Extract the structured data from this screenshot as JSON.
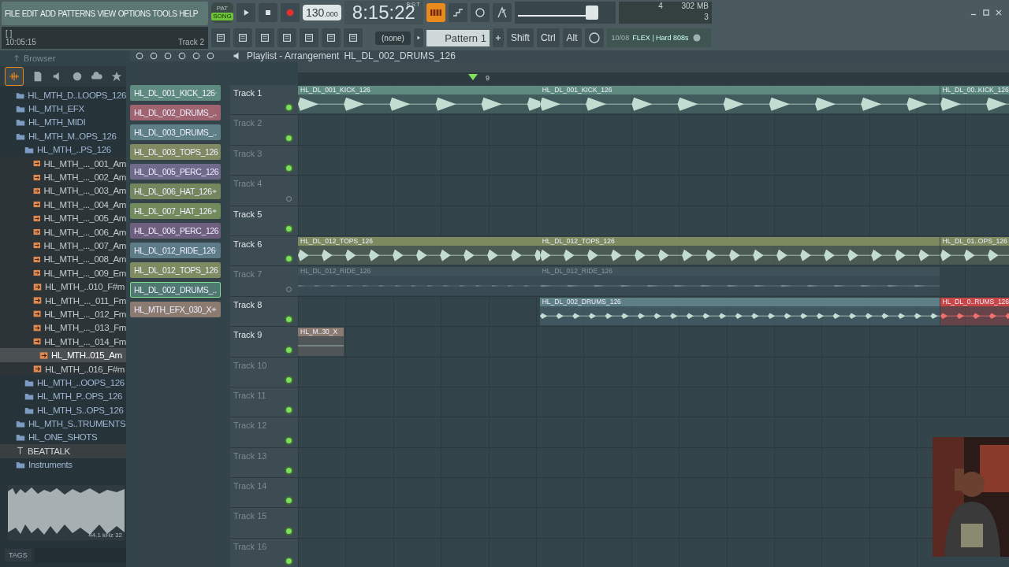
{
  "menu": [
    "FILE",
    "EDIT",
    "ADD",
    "PATTERNS",
    "VIEW",
    "OPTIONS",
    "TOOLS",
    "HELP"
  ],
  "mode": [
    {
      "label": "PAT",
      "selected": false
    },
    {
      "label": "SONG",
      "selected": true
    }
  ],
  "tempo": "130",
  "tempo_fraction": ".000",
  "time": "8:15:22",
  "time_format": "B:S:T",
  "hint": {
    "bracket": "[ ]",
    "time": "10:05:15",
    "target": "Track 2"
  },
  "cpu": {
    "polyphony": "4",
    "memory": "302 MB",
    "cores": "3"
  },
  "pattern_selector": {
    "channel": "(none)",
    "pattern": "Pattern 1"
  },
  "master_volume": {
    "level": 0.82
  },
  "modifier_keys": [
    "Shift",
    "Ctrl",
    "Alt"
  ],
  "news": {
    "date": "10/08",
    "text": "FLEX | Hard 808s"
  },
  "browser": {
    "title": "Browser",
    "tree": [
      {
        "label": "HL_MTH_D..LOOPS_126",
        "kind": "folder",
        "selected": false
      },
      {
        "label": "HL_MTH_EFX",
        "kind": "folder",
        "selected": false
      },
      {
        "label": "HL_MTH_MIDI",
        "kind": "folder",
        "selected": false
      },
      {
        "label": "HL_MTH_M..OPS_126",
        "kind": "folder",
        "selected": false,
        "children": [
          {
            "label": "HL_MTH_..PS_126",
            "kind": "folder",
            "selected": false,
            "children": [
              {
                "label": "HL_MTH_..._001_Am",
                "kind": "audio",
                "selected": false
              },
              {
                "label": "HL_MTH_..._002_Am",
                "kind": "audio",
                "selected": false
              },
              {
                "label": "HL_MTH_..._003_Am",
                "kind": "audio",
                "selected": false
              },
              {
                "label": "HL_MTH_..._004_Am",
                "kind": "audio",
                "selected": false
              },
              {
                "label": "HL_MTH_..._005_Am",
                "kind": "audio",
                "selected": false
              },
              {
                "label": "HL_MTH_..._006_Am",
                "kind": "audio",
                "selected": false
              },
              {
                "label": "HL_MTH_..._007_Am",
                "kind": "audio",
                "selected": false
              },
              {
                "label": "HL_MTH_..._008_Am",
                "kind": "audio",
                "selected": false
              },
              {
                "label": "HL_MTH_..._009_Em",
                "kind": "audio",
                "selected": false
              },
              {
                "label": "HL_MTH_..010_F#m",
                "kind": "audio",
                "selected": false
              },
              {
                "label": "HL_MTH_..._011_Fm",
                "kind": "audio",
                "selected": false
              },
              {
                "label": "HL_MTH_..._012_Fm",
                "kind": "audio",
                "selected": false
              },
              {
                "label": "HL_MTH_..._013_Fm",
                "kind": "audio",
                "selected": false
              },
              {
                "label": "HL_MTH_..._014_Fm",
                "kind": "audio",
                "selected": false
              },
              {
                "label": "HL_MTH..015_Am",
                "kind": "audio",
                "selected": true
              },
              {
                "label": "HL_MTH_..016_F#m",
                "kind": "audio",
                "selected": false
              }
            ]
          },
          {
            "label": "HL_MTH_..OOPS_126",
            "kind": "folder",
            "selected": false
          },
          {
            "label": "HL_MTH_P..OPS_126",
            "kind": "folder",
            "selected": false
          },
          {
            "label": "HL_MTH_S..OPS_126",
            "kind": "folder",
            "selected": false
          }
        ]
      },
      {
        "label": "HL_MTH_S..TRUMENTS",
        "kind": "folder",
        "selected": false
      },
      {
        "label": "HL_ONE_SHOTS",
        "kind": "folder",
        "selected": false
      },
      {
        "label": "BEATTALK",
        "kind": "text",
        "selected": false
      },
      {
        "label": "Instruments",
        "kind": "folder",
        "selected": false
      }
    ],
    "sample_info": "44.1 kHz 32",
    "tags_label": "TAGS"
  },
  "picker": [
    {
      "label": "HL_DL_001_KICK_126",
      "color": "#5f8a80",
      "selected": false
    },
    {
      "label": "HL_DL_002_DRUMS_..",
      "color": "#a06470",
      "selected": false
    },
    {
      "label": "HL_DL_003_DRUMS_..",
      "color": "#5e7f86",
      "selected": false
    },
    {
      "label": "HL_DL_003_TOPS_126",
      "color": "#7f8a62",
      "selected": false
    },
    {
      "label": "HL_DL_005_PERC_126",
      "color": "#6f6a8a",
      "selected": false
    },
    {
      "label": "HL_DL_006_HAT_126",
      "color": "#74865e",
      "selected": false
    },
    {
      "label": "HL_DL_007_HAT_126",
      "color": "#738a5c",
      "selected": false
    },
    {
      "label": "HL_DL_006_PERC_126",
      "color": "#6e5f7e",
      "selected": false
    },
    {
      "label": "HL_DL_012_RIDE_126",
      "color": "#5c7b86",
      "selected": false
    },
    {
      "label": "HL_DL_012_TOPS_126",
      "color": "#7e8a60",
      "selected": false
    },
    {
      "label": "HL_DL_002_DRUMS_..",
      "color": "#4f7870",
      "selected": true
    },
    {
      "label": "HL_MTH_EFX_030_X",
      "color": "#8a7a70",
      "selected": false
    }
  ],
  "playlist": {
    "title": "Playlist - Arrangement",
    "pattern": "HL_DL_002_DRUMS_126",
    "ruler_label": "9",
    "tracks": [
      {
        "name": "Track 1",
        "muted": false,
        "greyed": false,
        "clips": [
          {
            "label": "HL_DL_001_KICK_126",
            "color": "#5f8a80",
            "muted": false
          },
          {
            "label": "HL_DL_001_KICK_126",
            "color": "#5f8a80",
            "muted": false
          },
          {
            "label": "HL_DL_00..KICK_126",
            "color": "#5f8a80",
            "muted": false
          }
        ]
      },
      {
        "name": "Track 2",
        "muted": false,
        "greyed": true
      },
      {
        "name": "Track 3",
        "muted": false,
        "greyed": true
      },
      {
        "name": "Track 4",
        "muted": true,
        "greyed": true
      },
      {
        "name": "Track 5",
        "muted": false,
        "greyed": false
      },
      {
        "name": "Track 6",
        "muted": false,
        "greyed": false,
        "clips": [
          {
            "label": "HL_DL_012_TOPS_126",
            "color": "#7e8a60",
            "muted": false
          },
          {
            "label": "HL_DL_012_TOPS_126",
            "color": "#7e8a60",
            "muted": false
          },
          {
            "label": "HL_DL_01..OPS_126",
            "color": "#7e8a60",
            "muted": false
          }
        ]
      },
      {
        "name": "Track 7",
        "muted": true,
        "greyed": true,
        "clips": [
          {
            "label": "HL_DL_012_RIDE_126",
            "color": "#3f5159",
            "muted": true
          },
          {
            "label": "HL_DL_012_RIDE_126",
            "color": "#3f5159",
            "muted": true
          }
        ]
      },
      {
        "name": "Track 8",
        "muted": false,
        "greyed": false,
        "clips": [
          {
            "label": "HL_DL_002_DRUMS_126",
            "color": "#5e7f86",
            "muted": false
          },
          {
            "label": "HL_DL_0..RUMS_126",
            "color": "#c84646",
            "muted": false
          }
        ]
      },
      {
        "name": "Track 9",
        "muted": false,
        "greyed": false,
        "clips": [
          {
            "label": "HL_M..30_X",
            "color": "#8a7a70",
            "muted": false
          }
        ]
      },
      {
        "name": "Track 10",
        "muted": false,
        "greyed": true
      },
      {
        "name": "Track 11",
        "muted": false,
        "greyed": true
      },
      {
        "name": "Track 12",
        "muted": false,
        "greyed": true
      },
      {
        "name": "Track 13",
        "muted": false,
        "greyed": true
      },
      {
        "name": "Track 14",
        "muted": false,
        "greyed": true
      },
      {
        "name": "Track 15",
        "muted": false,
        "greyed": true
      },
      {
        "name": "Track 16",
        "muted": false,
        "greyed": true
      }
    ]
  }
}
